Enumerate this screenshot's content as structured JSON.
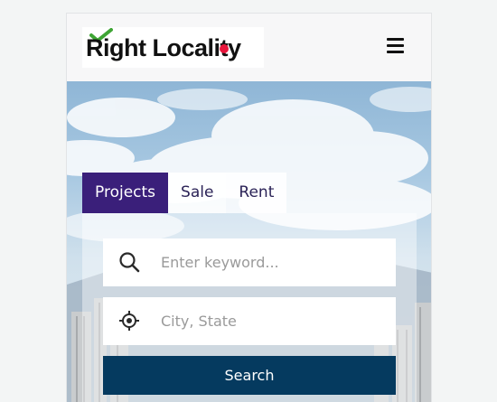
{
  "header": {
    "logo_text": "Right Locality",
    "menu_icon": "hamburger-menu-icon"
  },
  "tabs": [
    {
      "label": "Projects",
      "active": true
    },
    {
      "label": "Sale",
      "active": false
    },
    {
      "label": "Rent",
      "active": false
    }
  ],
  "search": {
    "keyword_placeholder": "Enter keyword...",
    "keyword_icon": "search-icon",
    "location_placeholder": "City, State",
    "location_icon": "crosshair-location-icon",
    "button_label": "Search"
  },
  "colors": {
    "active_tab": "#3a1f7a",
    "search_button": "#053a5f",
    "logo_check": "#3fa535",
    "logo_accent": "#e8163c"
  }
}
